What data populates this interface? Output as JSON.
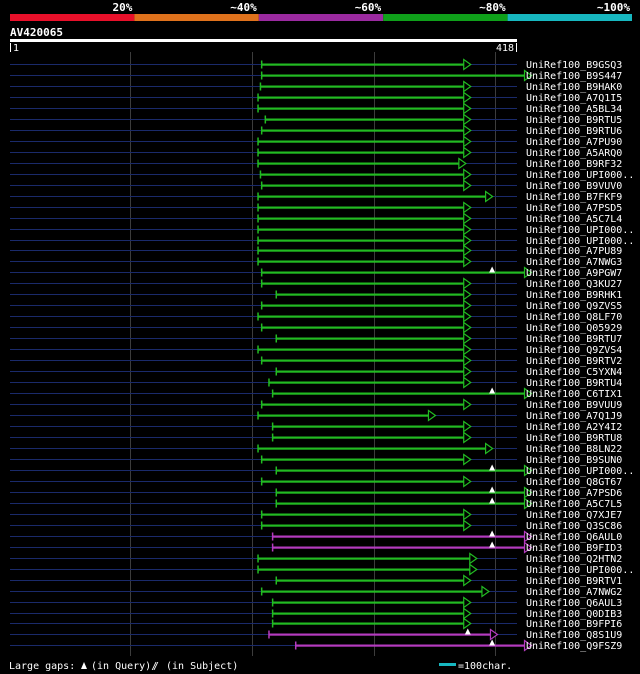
{
  "chart_data": {
    "type": "alignment",
    "identity_legend": [
      {
        "label": "20%",
        "color": "#e8102a"
      },
      {
        "label": "~40%",
        "color": "#e0721c"
      },
      {
        "label": "~60%",
        "color": "#9b2aa0"
      },
      {
        "label": "~80%",
        "color": "#0fa01a"
      },
      {
        "label": "~100%",
        "color": "#17b7c0"
      }
    ],
    "query": {
      "name": "AV420065",
      "start_label": "1",
      "end_label": "418",
      "length": 418
    },
    "hits": [
      {
        "name": "UniRef100_B9GSQ3",
        "start": 208,
        "end": 375,
        "identity": 80,
        "full_to": 375
      },
      {
        "name": "UniRef100_B9S447",
        "start": 208,
        "end": 425,
        "identity": 80,
        "full_to": 425
      },
      {
        "name": "UniRef100_B9HAK0",
        "start": 207,
        "end": 375,
        "identity": 80,
        "full_to": 375
      },
      {
        "name": "UniRef100_A7Q1I5",
        "start": 205,
        "end": 375,
        "identity": 80,
        "full_to": 375
      },
      {
        "name": "UniRef100_A5BL34",
        "start": 205,
        "end": 375,
        "identity": 80,
        "full_to": 375
      },
      {
        "name": "UniRef100_B9RTU5",
        "start": 211,
        "end": 375,
        "identity": 80,
        "full_to": 375
      },
      {
        "name": "UniRef100_B9RTU6",
        "start": 208,
        "end": 375,
        "identity": 80,
        "full_to": 375
      },
      {
        "name": "UniRef100_A7PU90",
        "start": 205,
        "end": 375,
        "identity": 80,
        "full_to": 375
      },
      {
        "name": "UniRef100_A5ARQ0",
        "start": 205,
        "end": 375,
        "identity": 80,
        "full_to": 375
      },
      {
        "name": "UniRef100_B9RF32",
        "start": 205,
        "end": 371,
        "identity": 80,
        "full_to": 371
      },
      {
        "name": "UniRef100_UPI000..",
        "start": 207,
        "end": 375,
        "identity": 80,
        "full_to": 375
      },
      {
        "name": "UniRef100_B9VUV0",
        "start": 208,
        "end": 375,
        "identity": 80,
        "full_to": 375
      },
      {
        "name": "UniRef100_B7FKF9",
        "start": 205,
        "end": 393,
        "identity": 80,
        "full_to": 393
      },
      {
        "name": "UniRef100_A7PSD5",
        "start": 205,
        "end": 375,
        "identity": 80,
        "full_to": 375
      },
      {
        "name": "UniRef100_A5C7L4",
        "start": 205,
        "end": 375,
        "identity": 80,
        "full_to": 375
      },
      {
        "name": "UniRef100_UPI000..",
        "start": 205,
        "end": 375,
        "identity": 80,
        "full_to": 375
      },
      {
        "name": "UniRef100_UPI000..",
        "start": 205,
        "end": 375,
        "identity": 80,
        "full_to": 375
      },
      {
        "name": "UniRef100_A7PU89",
        "start": 205,
        "end": 375,
        "identity": 80,
        "full_to": 375
      },
      {
        "name": "UniRef100_A7NWG3",
        "start": 205,
        "end": 375,
        "identity": 80,
        "full_to": 375
      },
      {
        "name": "UniRef100_A9PGW7",
        "start": 208,
        "end": 400,
        "identity": 80,
        "full_to": 425
      },
      {
        "name": "UniRef100_Q3KU27",
        "start": 208,
        "end": 375,
        "identity": 80,
        "full_to": 375
      },
      {
        "name": "UniRef100_B9RHK1",
        "start": 220,
        "end": 375,
        "identity": 80,
        "full_to": 375
      },
      {
        "name": "UniRef100_Q9ZVS5",
        "start": 208,
        "end": 375,
        "identity": 80,
        "full_to": 375
      },
      {
        "name": "UniRef100_Q8LF70",
        "start": 205,
        "end": 375,
        "identity": 80,
        "full_to": 375
      },
      {
        "name": "UniRef100_Q05929",
        "start": 208,
        "end": 375,
        "identity": 80,
        "full_to": 375
      },
      {
        "name": "UniRef100_B9RTU7",
        "start": 220,
        "end": 375,
        "identity": 80,
        "full_to": 375
      },
      {
        "name": "UniRef100_Q9ZVS4",
        "start": 205,
        "end": 375,
        "identity": 80,
        "full_to": 375
      },
      {
        "name": "UniRef100_B9RTV2",
        "start": 208,
        "end": 375,
        "identity": 80,
        "full_to": 375
      },
      {
        "name": "UniRef100_C5YXN4",
        "start": 220,
        "end": 375,
        "identity": 80,
        "full_to": 375
      },
      {
        "name": "UniRef100_B9RTU4",
        "start": 214,
        "end": 375,
        "identity": 80,
        "full_to": 375
      },
      {
        "name": "UniRef100_C6TIX1",
        "start": 217,
        "end": 400,
        "identity": 80,
        "full_to": 425
      },
      {
        "name": "UniRef100_B9VUU9",
        "start": 208,
        "end": 375,
        "identity": 80,
        "full_to": 375
      },
      {
        "name": "UniRef100_A7Q1J9",
        "start": 205,
        "end": 346,
        "identity": 80,
        "full_to": 346
      },
      {
        "name": "UniRef100_A2Y4I2",
        "start": 217,
        "end": 375,
        "identity": 80,
        "full_to": 375
      },
      {
        "name": "UniRef100_B9RTU8",
        "start": 217,
        "end": 375,
        "identity": 80,
        "full_to": 375
      },
      {
        "name": "UniRef100_B8LN22",
        "start": 205,
        "end": 393,
        "identity": 80,
        "full_to": 393
      },
      {
        "name": "UniRef100_B9SUN0",
        "start": 208,
        "end": 375,
        "identity": 80,
        "full_to": 375
      },
      {
        "name": "UniRef100_UPI000..",
        "start": 220,
        "end": 400,
        "identity": 80,
        "full_to": 425
      },
      {
        "name": "UniRef100_Q8GT67",
        "start": 208,
        "end": 375,
        "identity": 80,
        "full_to": 375
      },
      {
        "name": "UniRef100_A7PSD6",
        "start": 220,
        "end": 400,
        "identity": 80,
        "full_to": 425
      },
      {
        "name": "UniRef100_A5C7L5",
        "start": 220,
        "end": 400,
        "identity": 80,
        "full_to": 425
      },
      {
        "name": "UniRef100_Q7XJE7",
        "start": 208,
        "end": 375,
        "identity": 80,
        "full_to": 375
      },
      {
        "name": "UniRef100_Q3SC86",
        "start": 208,
        "end": 375,
        "identity": 80,
        "full_to": 375
      },
      {
        "name": "UniRef100_Q6AUL0",
        "start": 217,
        "end": 400,
        "identity": 60,
        "full_to": 425
      },
      {
        "name": "UniRef100_B9FID3",
        "start": 217,
        "end": 400,
        "identity": 60,
        "full_to": 425
      },
      {
        "name": "UniRef100_Q2HTN2",
        "start": 205,
        "end": 380,
        "identity": 80,
        "full_to": 380
      },
      {
        "name": "UniRef100_UPI000..",
        "start": 205,
        "end": 380,
        "identity": 80,
        "full_to": 380
      },
      {
        "name": "UniRef100_B9RTV1",
        "start": 220,
        "end": 375,
        "identity": 80,
        "full_to": 375
      },
      {
        "name": "UniRef100_A7NWG2",
        "start": 208,
        "end": 390,
        "identity": 80,
        "full_to": 390
      },
      {
        "name": "UniRef100_Q6AUL3",
        "start": 217,
        "end": 375,
        "identity": 80,
        "full_to": 375
      },
      {
        "name": "UniRef100_Q0DIB3",
        "start": 217,
        "end": 375,
        "identity": 80,
        "full_to": 375
      },
      {
        "name": "UniRef100_B9FPI6",
        "start": 217,
        "end": 375,
        "identity": 80,
        "full_to": 375
      },
      {
        "name": "UniRef100_Q8S1U9",
        "start": 214,
        "end": 380,
        "identity": 60,
        "full_to": 397
      },
      {
        "name": "UniRef100_Q9FSZ9",
        "start": 236,
        "end": 400,
        "identity": 60,
        "full_to": 425
      }
    ],
    "footer": {
      "gap_text_prefix": "Large gaps:",
      "gap_text_query": "(in Query)/",
      "gap_text_subject": "(in Subject)",
      "scale_text": "=100char.",
      "scale_color": "#17b7c0"
    },
    "grid": true
  }
}
